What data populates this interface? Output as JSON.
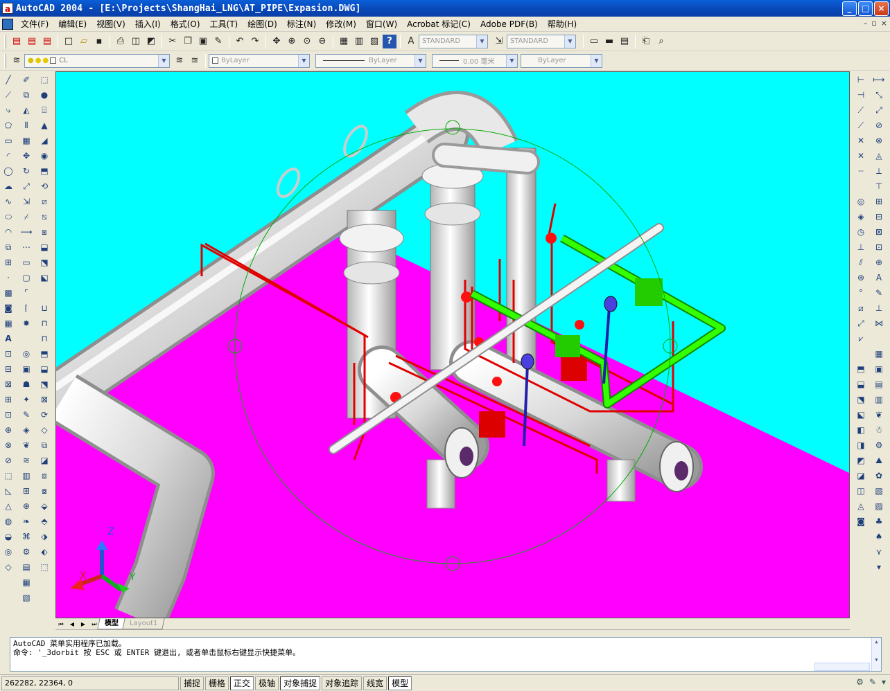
{
  "window": {
    "title": "AutoCAD 2004 - [E:\\Projects\\ShangHai_LNG\\AT_PIPE\\Expasion.DWG]",
    "min": "_",
    "max": "□",
    "close": "×"
  },
  "menu": [
    "文件(F)",
    "编辑(E)",
    "视图(V)",
    "插入(I)",
    "格式(O)",
    "工具(T)",
    "绘图(D)",
    "标注(N)",
    "修改(M)",
    "窗口(W)",
    "Acrobat 标记(C)",
    "Adobe PDF(B)",
    "帮助(H)"
  ],
  "mdi": {
    "min": "–",
    "restore": "▫",
    "close": "×"
  },
  "styles": {
    "text_style": "STANDARD",
    "dim_style": "STANDARD"
  },
  "layers": {
    "current_layer": "CL",
    "color": "ByLayer",
    "linetype": "ByLayer",
    "lineweight": "0.00 毫米",
    "plotstyle": "ByLayer"
  },
  "tabs": {
    "model": "模型",
    "layout1": "Layout1"
  },
  "command": {
    "line1": "AutoCAD 菜单实用程序已加载。",
    "line2": "命令: '_3dorbit 按 ESC 或 ENTER 键退出, 或者单击鼠标右键显示快捷菜单。"
  },
  "status": {
    "coords": "262282, 22364, 0",
    "buttons": [
      {
        "label": "捕捉",
        "on": false
      },
      {
        "label": "栅格",
        "on": false
      },
      {
        "label": "正交",
        "on": true
      },
      {
        "label": "极轴",
        "on": false
      },
      {
        "label": "对象捕捉",
        "on": true
      },
      {
        "label": "对象追踪",
        "on": false
      },
      {
        "label": "线宽",
        "on": false
      },
      {
        "label": "模型",
        "on": true
      }
    ]
  },
  "ucs": {
    "x": "X",
    "y": "Y",
    "z": "Z"
  },
  "colors": {
    "viewport_bg": "#00FFFF",
    "ground": "#FF00FF",
    "pipe": "#D8D8D8",
    "red_pipe": "#E00000",
    "green_pipe": "#22DD00",
    "orbit": "#00AA00"
  }
}
